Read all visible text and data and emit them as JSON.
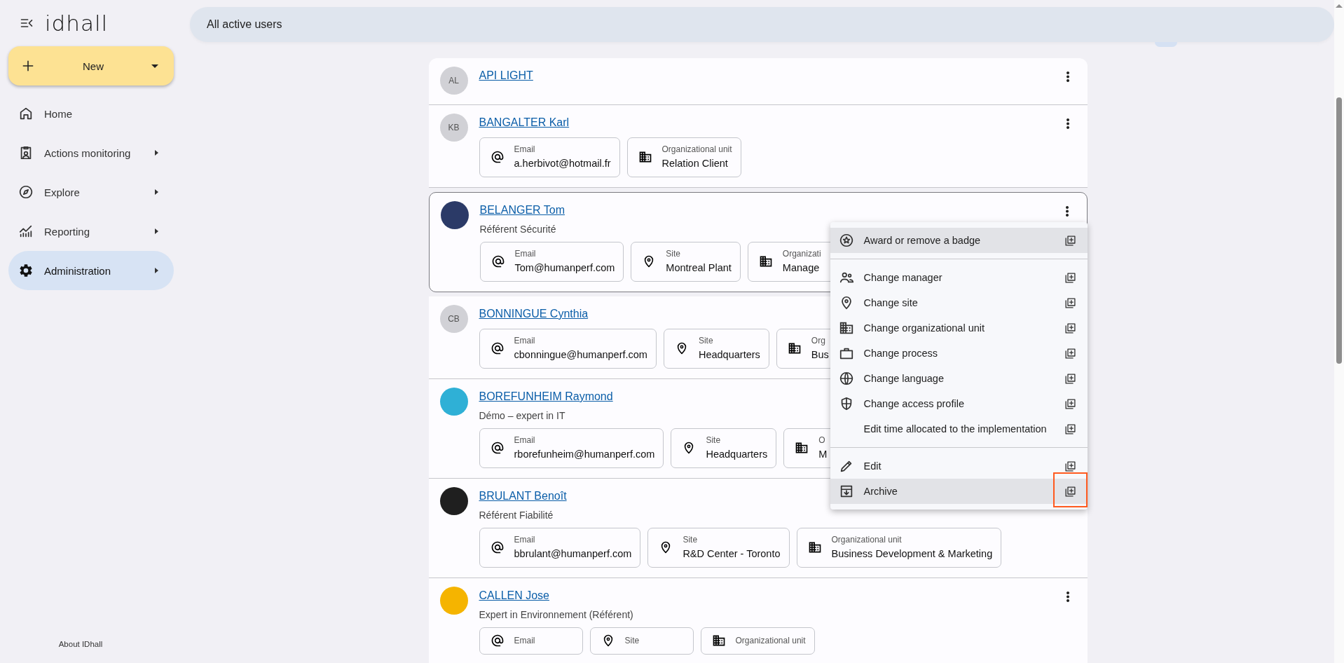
{
  "sidebar": {
    "logo": "idhall",
    "new_button": {
      "label": "New"
    },
    "nav": [
      {
        "label": "Home",
        "has_submenu": false,
        "selected": false
      },
      {
        "label": "Actions monitoring",
        "has_submenu": true,
        "selected": false
      },
      {
        "label": "Explore",
        "has_submenu": true,
        "selected": false
      },
      {
        "label": "Reporting",
        "has_submenu": true,
        "selected": false
      },
      {
        "label": "Administration",
        "has_submenu": true,
        "selected": true
      }
    ],
    "footer_link": "About IDhall"
  },
  "header": {
    "title": "All active users"
  },
  "users": [
    {
      "name": "API LIGHT",
      "avatar": {
        "kind": "initials",
        "initials": "AL"
      },
      "selected": false
    },
    {
      "name": "BANGALTER Karl",
      "avatar": {
        "kind": "initials",
        "initials": "KB"
      },
      "selected": false,
      "chips": [
        {
          "kind": "email",
          "label": "Email",
          "value": "a.herbivot@hotmail.fr"
        },
        {
          "kind": "org",
          "label": "Organizational unit",
          "value": "Relation Client"
        }
      ]
    },
    {
      "name": "BELANGER Tom",
      "avatar": {
        "kind": "photo",
        "color": "#2b3a67"
      },
      "subtitle": "Référent Sécurité",
      "selected": true,
      "chips": [
        {
          "kind": "email",
          "label": "Email",
          "value": "Tom@humanperf.com"
        },
        {
          "kind": "site",
          "label": "Site",
          "value": "Montreal Plant"
        },
        {
          "kind": "org",
          "label": "Organizati",
          "value": "Manage"
        }
      ]
    },
    {
      "name": "BONNINGUE Cynthia",
      "avatar": {
        "kind": "initials",
        "initials": "CB"
      },
      "selected": false,
      "chips": [
        {
          "kind": "email",
          "label": "Email",
          "value": "cbonningue@humanperf.com"
        },
        {
          "kind": "site",
          "label": "Site",
          "value": "Headquarters"
        },
        {
          "kind": "org",
          "label": "Org",
          "value": "Bus"
        }
      ]
    },
    {
      "name": "BOREFUNHEIM Raymond",
      "avatar": {
        "kind": "photo",
        "color": "#2fb0d6"
      },
      "subtitle": "Démo – expert in IT",
      "selected": false,
      "chips": [
        {
          "kind": "email",
          "label": "Email",
          "value": "rborefunheim@humanperf.com"
        },
        {
          "kind": "site",
          "label": "Site",
          "value": "Headquarters"
        },
        {
          "kind": "org",
          "label": "O",
          "value": "M"
        }
      ]
    },
    {
      "name": "BRULANT Benoît",
      "avatar": {
        "kind": "photo",
        "color": "#1f1f1f"
      },
      "subtitle": "Référent Fiabilité",
      "selected": false,
      "chips": [
        {
          "kind": "email",
          "label": "Email",
          "value": "bbrulant@humanperf.com"
        },
        {
          "kind": "site",
          "label": "Site",
          "value": "R&D Center - Toronto"
        },
        {
          "kind": "org",
          "label": "Organizational unit",
          "value": "Business Development & Marketing"
        }
      ]
    },
    {
      "name": "CALLEN Jose",
      "avatar": {
        "kind": "photo",
        "color": "#f5b400"
      },
      "subtitle": "Expert in Environnement (Référent)",
      "selected": false,
      "chips": [
        {
          "kind": "email",
          "label": "Email"
        },
        {
          "kind": "site",
          "label": "Site"
        },
        {
          "kind": "org",
          "label": "Organizational unit"
        }
      ]
    }
  ],
  "menu": {
    "groups": [
      {
        "items": [
          {
            "label": "Award or remove a badge",
            "highlighted": true,
            "annotated": false
          }
        ]
      },
      {
        "items": [
          {
            "label": "Change manager",
            "highlighted": false,
            "annotated": false
          },
          {
            "label": "Change site",
            "highlighted": false,
            "annotated": false
          },
          {
            "label": "Change organizational unit",
            "highlighted": false,
            "annotated": false
          },
          {
            "label": "Change process",
            "highlighted": false,
            "annotated": false
          },
          {
            "label": "Change language",
            "highlighted": false,
            "annotated": false
          },
          {
            "label": "Change access profile",
            "highlighted": false,
            "annotated": false
          },
          {
            "label": "Edit time allocated to the implementation",
            "highlighted": false,
            "annotated": false
          }
        ]
      },
      {
        "items": [
          {
            "label": "Edit",
            "highlighted": false,
            "annotated": false
          },
          {
            "label": "Archive",
            "highlighted": true,
            "annotated": true
          }
        ]
      }
    ]
  }
}
